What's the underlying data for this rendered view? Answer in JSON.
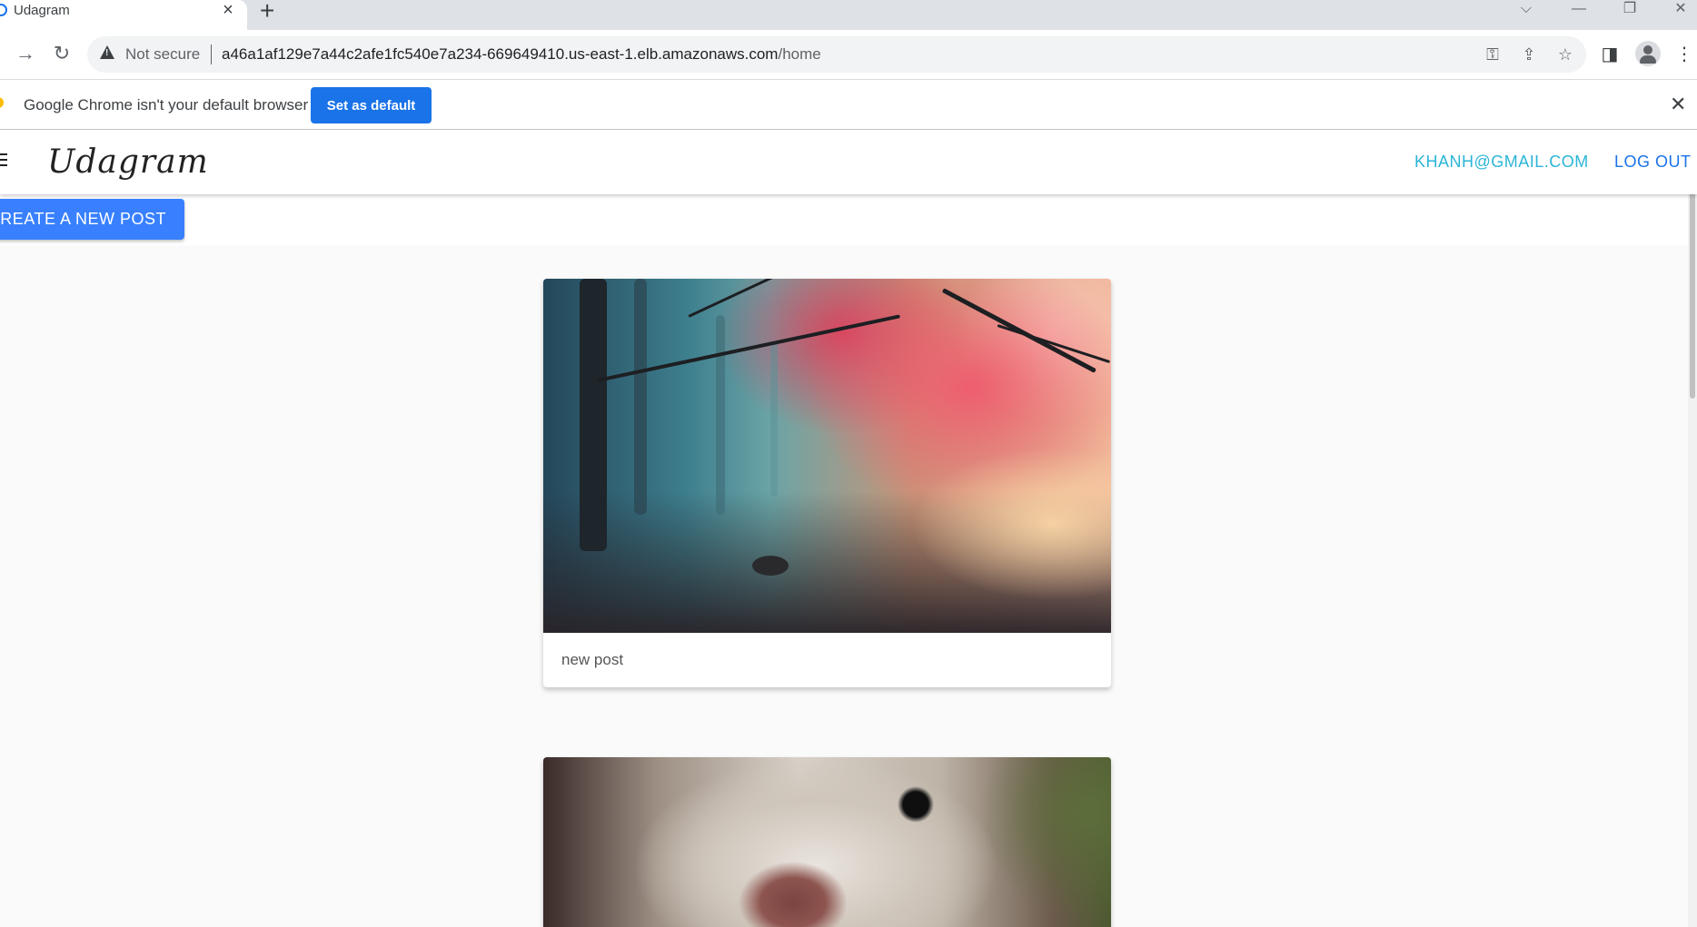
{
  "browser": {
    "tab": {
      "title": "Udagram",
      "close_icon": "close-icon"
    },
    "new_tab_label": "+",
    "window_controls": [
      "chevron-down-icon",
      "minimize-icon",
      "restore-icon",
      "close-icon"
    ],
    "security_label": "Not secure",
    "url_host": "a46a1af129e7a44c2afe1fc540e7a234-669649410.us-east-1.elb.amazonaws.com",
    "url_path": "/home",
    "toolbar_icons": [
      "key-icon",
      "share-icon",
      "star-icon",
      "sidebar-icon",
      "profile-icon",
      "kebab-menu-icon"
    ]
  },
  "infobar": {
    "message": "Google Chrome isn't your default browser",
    "button_label": "Set as default"
  },
  "app": {
    "brand": "Udagram",
    "user_email": "KHANH@GMAIL.COM",
    "logout_label": "LOG OUT",
    "create_post_label": "CREATE A NEW POST"
  },
  "feed": {
    "posts": [
      {
        "caption": "new post",
        "image": "forest-autumn-photo"
      },
      {
        "caption": "",
        "image": "dog-closeup-photo"
      }
    ]
  }
}
